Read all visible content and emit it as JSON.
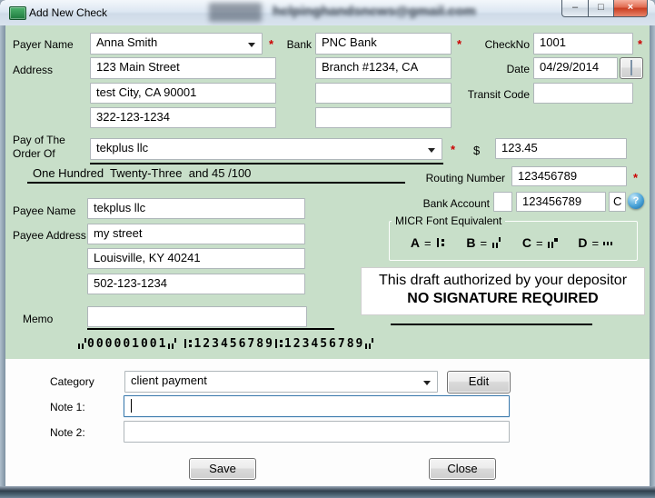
{
  "window": {
    "title": "Add New Check",
    "background_text": "helpinghandsnews@gmail.com",
    "controls": {
      "minimize": "–",
      "maximize": "□",
      "close": "×"
    }
  },
  "check": {
    "payer_name": {
      "label": "Payer Name",
      "value": "Anna Smith",
      "required": "*"
    },
    "address": {
      "label": "Address",
      "line1": "123 Main Street",
      "line2": "test City, CA 90001",
      "line3": "322-123-1234"
    },
    "bank": {
      "label": "Bank",
      "name": "PNC Bank",
      "branch": "Branch #1234, CA",
      "required": "*",
      "extra1": "",
      "extra2": ""
    },
    "check_no": {
      "label": "CheckNo",
      "value": "1001",
      "required": "*"
    },
    "date": {
      "label": "Date",
      "value": "04/29/2014"
    },
    "transit_code": {
      "label": "Transit Code",
      "value": ""
    },
    "pay_order": {
      "label_line1": "Pay of The",
      "label_line2": "Order Of",
      "value": "tekplus llc",
      "required": "*"
    },
    "amount": {
      "currency": "$",
      "value": "123.45"
    },
    "amount_in_words": "One Hundred  Twenty-Three  and 45 /100",
    "routing_number": {
      "label": "Routing Number",
      "value": "123456789",
      "required": "*"
    },
    "bank_account": {
      "label": "Bank Account",
      "box1": "",
      "value": "123456789",
      "box2": "C"
    },
    "micr_equivalent": {
      "title": "MICR Font Equivalent",
      "equals": "=",
      "items": [
        {
          "letter": "A",
          "symbol": "transit"
        },
        {
          "letter": "B",
          "symbol": "on-us"
        },
        {
          "letter": "C",
          "symbol": "amount"
        },
        {
          "letter": "D",
          "symbol": "dash"
        }
      ]
    },
    "payee": {
      "name_label": "Payee Name",
      "name": "tekplus llc",
      "address_label": "Payee Address",
      "address_line1": "my street",
      "address_line2": "Louisville, KY 40241",
      "address_line3": "502-123-1234"
    },
    "memo": {
      "label": "Memo",
      "value": ""
    },
    "draft_notice": {
      "line1": "This draft authorized by your depositor",
      "line2": "NO SIGNATURE REQUIRED"
    },
    "micr_line": "⑈000001001⑈ ⑆123456789⑆123456789⑈"
  },
  "footer": {
    "category": {
      "label": "Category",
      "value": "client payment"
    },
    "edit_button": "Edit",
    "note1": {
      "label": "Note 1:",
      "value": ""
    },
    "note2": {
      "label": "Note 2:",
      "value": ""
    },
    "save_button": "Save",
    "close_button": "Close"
  },
  "icons": {
    "help": "?"
  },
  "colors": {
    "panel_green": "#c8dfc9",
    "required": "#cc0000",
    "focus_border": "#3d7bad"
  }
}
